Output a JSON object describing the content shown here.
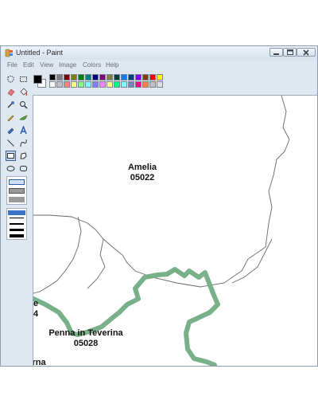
{
  "window": {
    "title": "Untitled - Paint",
    "controls": {
      "minimize": "—",
      "maximize": "▭",
      "close": "✕"
    }
  },
  "menu": [
    "File",
    "Edit",
    "View",
    "Image",
    "Colors",
    "Help"
  ],
  "tools": [
    "free-select-icon",
    "rect-select-icon",
    "eraser-icon",
    "fill-bucket-icon",
    "color-picker-icon",
    "magnifier-icon",
    "pencil-icon",
    "brush-icon",
    "airbrush-icon",
    "text-icon",
    "line-icon",
    "curve-icon",
    "rectangle-icon",
    "polygon-icon",
    "ellipse-icon",
    "rounded-rect-icon"
  ],
  "palette": {
    "foreground": "#000000",
    "background": "#ffffff",
    "row1": [
      "#000000",
      "#808080",
      "#800000",
      "#808000",
      "#008000",
      "#008080",
      "#000080",
      "#800080",
      "#808040",
      "#004040",
      "#0080ff",
      "#004080",
      "#8000ff",
      "#804000",
      "#ff0000",
      "#ffff00"
    ],
    "row2": [
      "#ffffff",
      "#c0c0c0",
      "#ff8080",
      "#ffff80",
      "#80ff80",
      "#80ffff",
      "#8080ff",
      "#ff80ff",
      "#ffff80",
      "#00ff80",
      "#80ffff",
      "#8080c0",
      "#ff0080",
      "#ff8040",
      "#c0c0c0",
      "#e0e0e0"
    ]
  },
  "map": {
    "labels": [
      {
        "name": "Amelia",
        "code": "05022"
      },
      {
        "name": "Penna in Teverina",
        "code": "05028"
      }
    ],
    "partial_labels": [
      "e",
      "4",
      "rna"
    ],
    "border_color": "#78b08a"
  }
}
